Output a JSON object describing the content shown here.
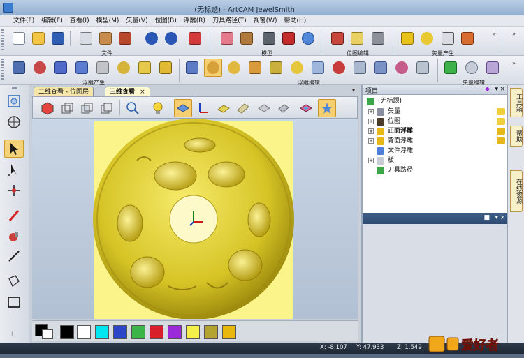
{
  "window": {
    "title": "(无标题) - ArtCAM JewelSmith"
  },
  "menu": [
    "文件(F)",
    "编辑(E)",
    "查看(I)",
    "模型(M)",
    "矢量(V)",
    "位图(B)",
    "浮雕(R)",
    "刀具路径(T)",
    "视窗(W)",
    "帮助(H)"
  ],
  "toolbar_groups": {
    "row1": [
      "文件",
      "模型",
      "位图编辑",
      "矢量产生"
    ],
    "row2": [
      "浮雕产生",
      "浮雕编辑",
      "矢量编辑"
    ]
  },
  "doc_tabs": {
    "tab1": "二维查看 - 位图层",
    "tab2": "三维查看"
  },
  "project": {
    "header": "项目",
    "root": "(无标题)",
    "items": [
      "矢量",
      "位图",
      "正面浮雕",
      "背面浮雕",
      "文件浮雕",
      "板",
      "刀具路径"
    ]
  },
  "side_tabs": [
    "工具箱",
    "帮助",
    "在线资源"
  ],
  "status": {
    "x": "X: -8.107",
    "y": "Y: 47.933",
    "z": "Z: 1.549"
  },
  "palette": {
    "colors": [
      "#000000",
      "#ffffff",
      "#00e6f0",
      "#2c46c8",
      "#3cb44a",
      "#d8202a",
      "#9b2bd8",
      "#f5ef4a",
      "#b3a331",
      "#e8b80f"
    ]
  },
  "watermark": "爱好者",
  "icons": {
    "left_tools": [
      "zoom-window-icon",
      "pan-globe-icon",
      "select-arrow-icon",
      "node-edit-icon",
      "transform-icon",
      "pencil-icon",
      "paint-icon",
      "line-icon",
      "fill-icon",
      "rectangle-icon"
    ]
  }
}
